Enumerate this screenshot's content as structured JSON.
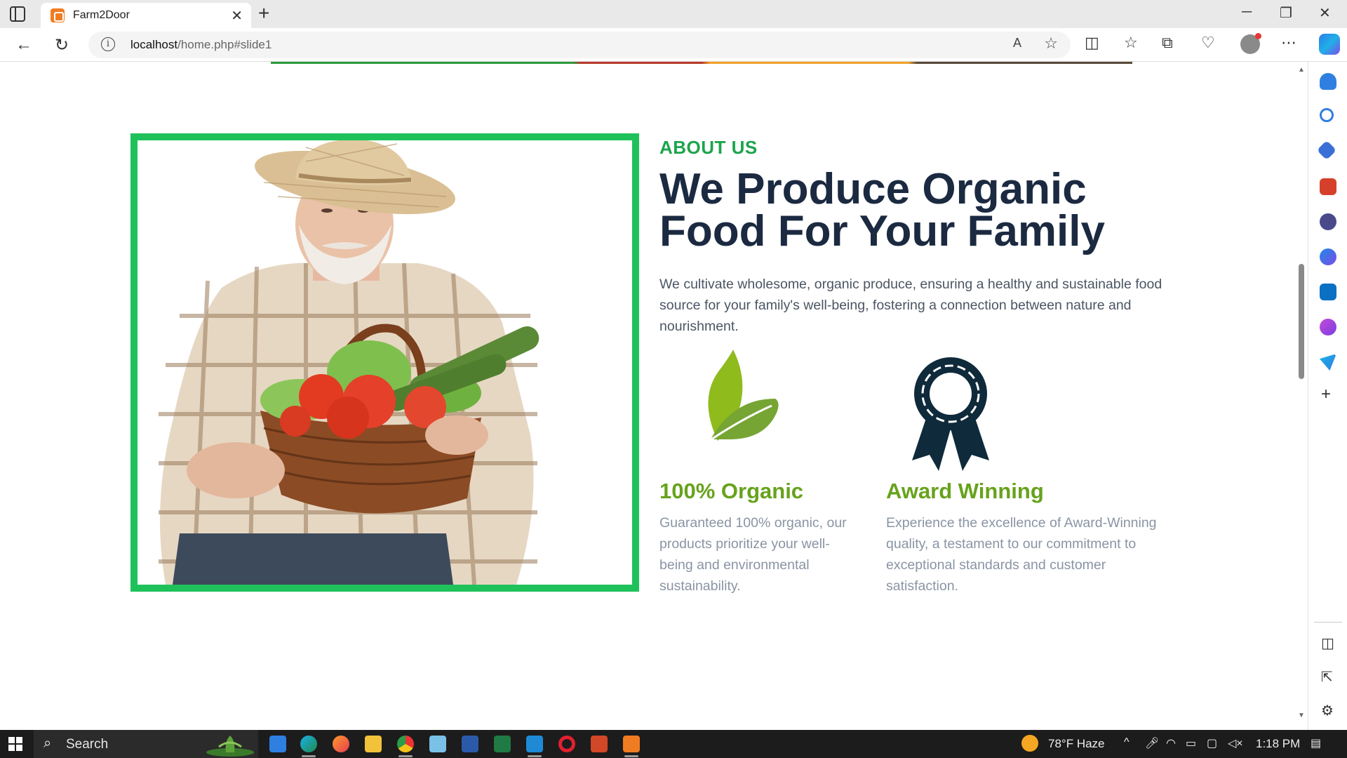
{
  "browser": {
    "tab_title": "Farm2Door",
    "url_host": "localhost",
    "url_rest": "/home.php#slide1"
  },
  "about": {
    "label": "ABOUT US",
    "headline": "We Produce Organic Food For Your Family",
    "description": "We cultivate wholesome, organic produce, ensuring a healthy and sustainable food source for your family's well-being, fostering a connection between nature and nourishment."
  },
  "features": [
    {
      "title": "100% Organic",
      "text": "Guaranteed 100% organic, our products prioritize your well-being and environmental sustainability.",
      "icon": "leaf-icon"
    },
    {
      "title": "Award Winning",
      "text": "Experience the excellence of Award-Winning quality, a testament to our commitment to exceptional standards and customer satisfaction.",
      "icon": "award-ribbon-icon"
    }
  ],
  "taskbar": {
    "search_label": "Search",
    "weather": "78°F  Haze",
    "time": "1:18 PM"
  },
  "colors": {
    "accent_green": "#1fc25a",
    "label_green": "#1da44d",
    "feature_green": "#67a21c",
    "heading_navy": "#1b2a41",
    "award_navy": "#0f2a3a"
  }
}
